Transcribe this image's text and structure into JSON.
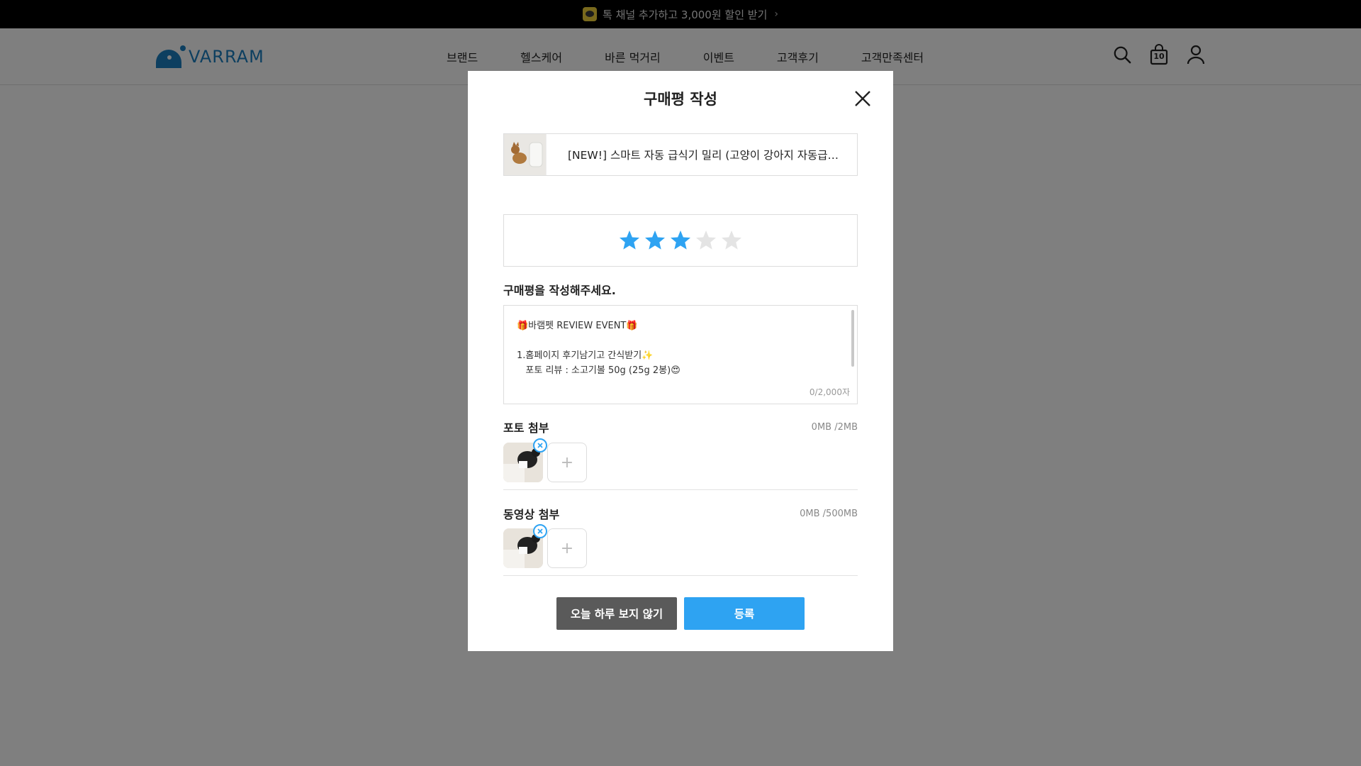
{
  "top_banner": {
    "text": "톡 채널 추가하고 3,000원 할인 받기",
    "chevron": "›",
    "icon": "kakao-talk-icon",
    "bg_color": "#000000"
  },
  "header": {
    "logo_text": "VARRAM",
    "brand_color": "#1b7fc0",
    "nav": [
      {
        "label": "브랜드"
      },
      {
        "label": "헬스케어"
      },
      {
        "label": "바른 먹거리"
      },
      {
        "label": "이벤트"
      },
      {
        "label": "고객후기"
      },
      {
        "label": "고객만족센터"
      }
    ],
    "cart_count": "10",
    "icons": [
      "search-icon",
      "cart-icon",
      "user-icon"
    ]
  },
  "modal": {
    "title": "구매평 작성",
    "product": {
      "name": "[NEW!] 스마트 자동 급식기 밀리 (고양이 강아지 자동급식..."
    },
    "rating": {
      "value": 3,
      "max": 5,
      "active_color": "#2ea3f2",
      "inactive_color": "#e4e4e4"
    },
    "review_label": "구매평을 작성해주세요.",
    "review_text": "🎁바램펫 REVIEW EVENT🎁\n\n1.홈페이지 후기남기고 간식받기✨\n   포토 리뷰 : 소고기볼 50g (25g 2봉)😍",
    "char_count": "0/2,000자",
    "photo": {
      "title": "포토 첨부",
      "size": "0MB /2MB",
      "add_label": "+"
    },
    "video": {
      "title": "동영상 첨부",
      "size": "0MB /500MB",
      "add_label": "+"
    },
    "buttons": {
      "dismiss": "오늘 하루 보지 않기",
      "submit": "등록"
    },
    "accent_color": "#2ea3f2"
  }
}
